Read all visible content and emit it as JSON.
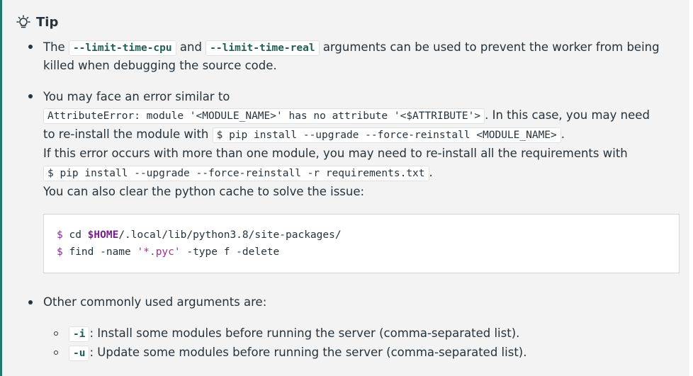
{
  "tip": {
    "title": "Tip",
    "icon": "lightbulb-icon",
    "accent_color": "#1f7a6b"
  },
  "item1": {
    "p1": "The ",
    "code1": "--limit-time-cpu",
    "p2": " and ",
    "code2": "--limit-time-real",
    "p3": " arguments can be used to prevent the worker from being",
    "line2": "killed when debugging the source code."
  },
  "item2": {
    "line1": "You may face an error similar to",
    "code_error": "AttributeError: module '<MODULE_NAME>' has no attribute '<$ATTRIBUTE'>",
    "after_error": ". In this case, you may need",
    "line3_pre": "to re-install the module with ",
    "code_pip1": "$ pip install --upgrade --force-reinstall <MODULE_NAME>",
    "line3_post": ".",
    "line4": "If this error occurs with more than one module, you may need to re-install all the requirements with",
    "code_pip2": "$ pip install --upgrade --force-reinstall -r requirements.txt",
    "line5_post": ".",
    "line6": "You can also clear the python cache to solve the issue:",
    "codeblock": {
      "l1_prompt": "$",
      "l1_cmd": " cd ",
      "l1_var": "$HOME",
      "l1_rest": "/.local/lib/python3.8/site-packages/",
      "l2_prompt": "$",
      "l2_cmd": " find -name ",
      "l2_str": "'*.pyc'",
      "l2_rest": " -type f -delete"
    }
  },
  "item3": {
    "line1": "Other commonly used arguments are:",
    "sub1_code": "-i",
    "sub1_text": ": Install some modules before running the server (comma-separated list).",
    "sub2_code": "-u",
    "sub2_text": ": Update some modules before running the server (comma-separated list)."
  }
}
